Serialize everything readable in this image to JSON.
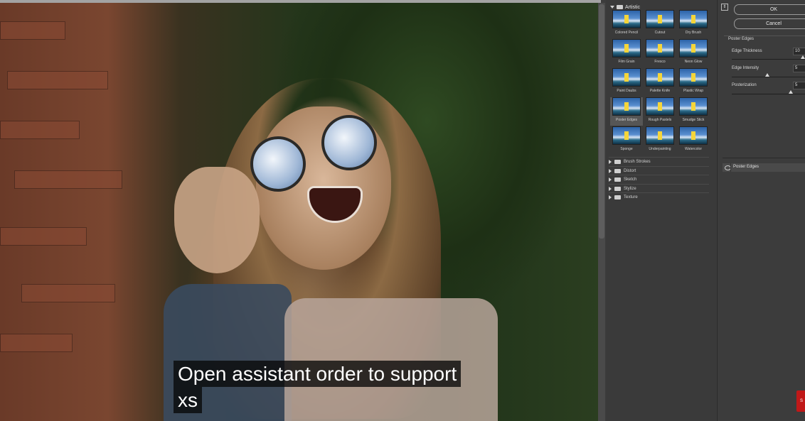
{
  "caption": {
    "line1": "Open assistant order to support",
    "line2": "xs"
  },
  "gallery": {
    "open_category": "Artistic",
    "thumbnails": [
      "Colored Pencil",
      "Cutout",
      "Dry Brush",
      "Film Grain",
      "Fresco",
      "Neon Glow",
      "Paint Daubs",
      "Palette Knife",
      "Plastic Wrap",
      "Poster Edges",
      "Rough Pastels",
      "Smudge Stick",
      "Sponge",
      "Underpainting",
      "Watercolor"
    ],
    "selected": "Poster Edges",
    "collapsed_categories": [
      "Brush Strokes",
      "Distort",
      "Sketch",
      "Stylize",
      "Texture"
    ]
  },
  "settings": {
    "ok_label": "OK",
    "cancel_label": "Cancel",
    "filter_name": "Poster Edges",
    "params": [
      {
        "label": "Edge Thickness",
        "value": "10",
        "fraction": 1.0
      },
      {
        "label": "Edge Intensity",
        "value": "5",
        "fraction": 0.5
      },
      {
        "label": "Posterization",
        "value": "5",
        "fraction": 0.83
      }
    ],
    "effect_layer": "Poster Edges"
  },
  "colors": {
    "selected_thumb": "#565656",
    "panel": "#3c3c3c",
    "badge": "#c01818"
  },
  "icons": {
    "eye": "eye-icon",
    "folder": "folder-icon",
    "expand": "triangle-right-icon",
    "collapse": "triangle-down-icon"
  }
}
